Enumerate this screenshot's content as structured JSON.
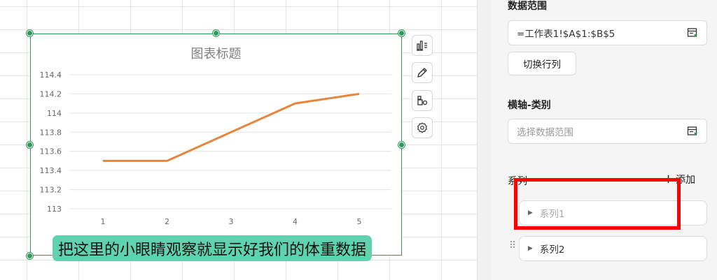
{
  "chart": {
    "title": "图表标题"
  },
  "chart_data": {
    "type": "line",
    "title": "图表标题",
    "categories": [
      "1",
      "2",
      "3",
      "4",
      "5"
    ],
    "series": [
      {
        "values": [
          113.5,
          113.5,
          113.8,
          114.1,
          114.2
        ],
        "color": "#e8853c"
      }
    ],
    "y_ticks": [
      "114.4",
      "114.2",
      "114",
      "113.8",
      "113.6",
      "113.4",
      "113.2",
      "113"
    ],
    "ylim": [
      113,
      114.4
    ],
    "grid": true,
    "line_color": "#e8853c"
  },
  "toolbar": {
    "icons": [
      "chart-type-icon",
      "pencil-icon",
      "chart-elements-icon",
      "gear-icon"
    ]
  },
  "caption": "把这里的小眼睛观察就显示好我们的体重数据",
  "panel": {
    "data_range_label": "数据范围",
    "data_range_value": "=工作表1!$A$1:$B$5",
    "switch_button": "切换行列",
    "category_axis_label": "横轴-类别",
    "category_axis_placeholder": "选择数据范围",
    "series_label": "系列",
    "add_label": "添加",
    "series": [
      "系列1",
      "系列2"
    ]
  },
  "colors": {
    "selection": "#2e9a5a",
    "line": "#e8853c",
    "caption_bg": "#5fd3ae",
    "highlight": "#ff0000"
  }
}
